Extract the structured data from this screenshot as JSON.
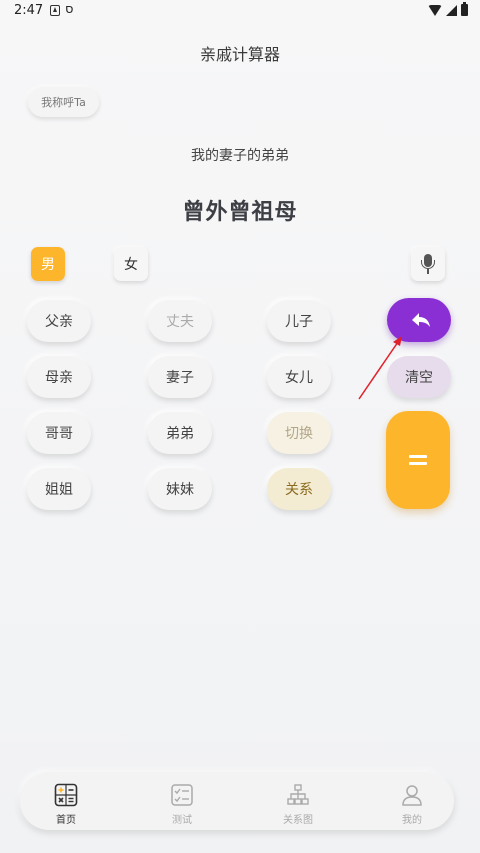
{
  "status_bar": {
    "time": "2:47",
    "icon_b": "ס"
  },
  "app_title": "亲戚计算器",
  "call_button_label": "我称呼Ta",
  "relation_text": "我的妻子的弟弟",
  "result_text": "曾外曾祖母",
  "gender": {
    "male": "男",
    "female": "女",
    "selected": "男"
  },
  "keys": {
    "father": "父亲",
    "husband": "丈夫",
    "son": "儿子",
    "mother": "母亲",
    "wife": "妻子",
    "daughter": "女儿",
    "elder_brother": "哥哥",
    "younger_brother": "弟弟",
    "switch": "切换",
    "elder_sister": "姐姐",
    "younger_sister": "妹妹",
    "relation": "关系",
    "clear": "清空"
  },
  "tabs": [
    {
      "label": "首页",
      "icon": "calculator-icon",
      "active": true
    },
    {
      "label": "测试",
      "icon": "checklist-icon",
      "active": false
    },
    {
      "label": "关系图",
      "icon": "tree-icon",
      "active": false
    },
    {
      "label": "我的",
      "icon": "user-icon",
      "active": false
    }
  ],
  "colors": {
    "accent_orange": "#fdb52c",
    "back_purple": "#8a2fd4",
    "clear_lavender": "#e6dcec",
    "arrow_red": "#e0202a"
  }
}
